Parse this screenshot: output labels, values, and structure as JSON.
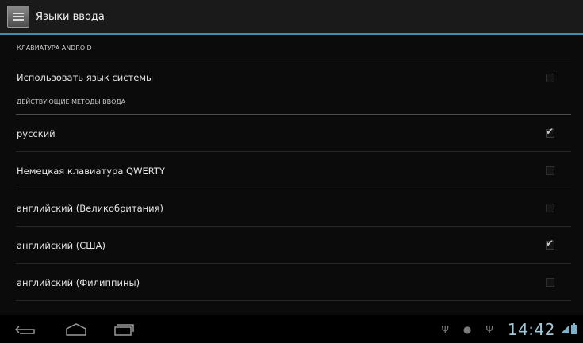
{
  "action_bar": {
    "title": "Языки ввода"
  },
  "sections": {
    "android_keyboard": "КЛАВИАТУРА ANDROID",
    "active_methods": "ДЕЙСТВУЮЩИЕ МЕТОДЫ ВВОДА"
  },
  "system_language": {
    "label": "Использовать язык системы",
    "checked": false
  },
  "languages": [
    {
      "label": "русский",
      "checked": true
    },
    {
      "label": "Немецкая клавиатура QWERTY",
      "checked": false
    },
    {
      "label": "английский (Великобритания)",
      "checked": false
    },
    {
      "label": "английский (США)",
      "checked": true
    },
    {
      "label": "английский (Филиппины)",
      "checked": false
    }
  ],
  "status_bar": {
    "time": "14:42",
    "icons": [
      "usb-icon",
      "android-debug-icon",
      "usb-icon",
      "signal-icon",
      "battery-icon"
    ]
  },
  "colors": {
    "accent": "#3a8fb7",
    "background": "#0b0b0b",
    "clock": "#9ec7d8"
  }
}
